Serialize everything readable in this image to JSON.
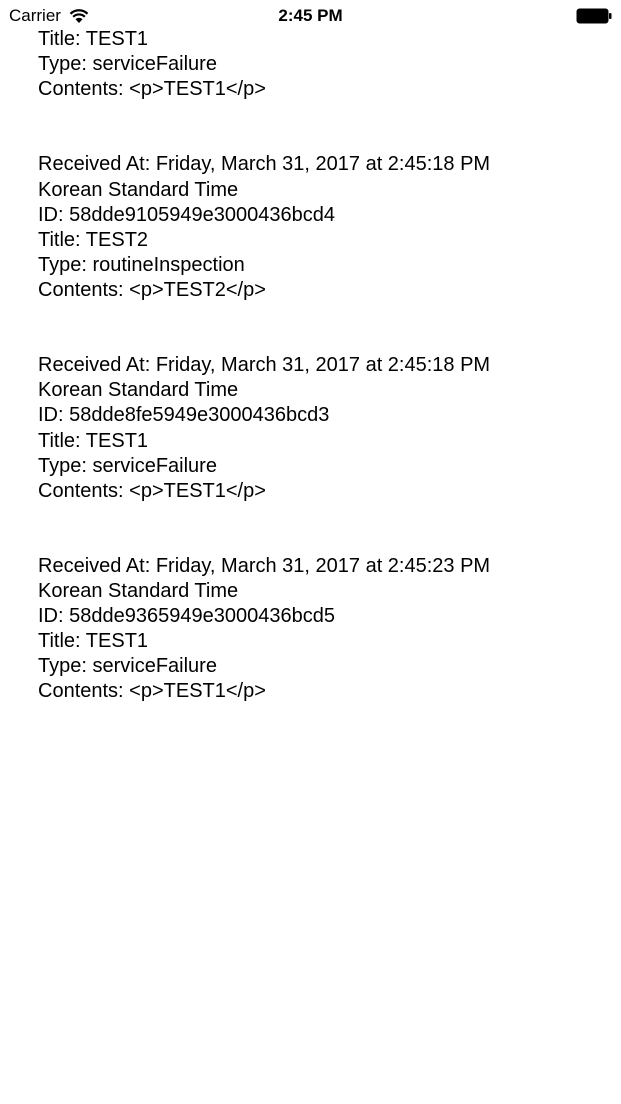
{
  "status_bar": {
    "carrier": "Carrier",
    "time": "2:45 PM"
  },
  "log": {
    "entry0": {
      "title": "Title: TEST1",
      "type": "Type: serviceFailure",
      "contents": "Contents: <p>TEST1</p>"
    },
    "entry1": {
      "received": "Received At: Friday, March 31, 2017 at 2:45:18 PM",
      "timezone": "Korean Standard Time",
      "id": "ID: 58dde9105949e3000436bcd4",
      "title": "Title: TEST2",
      "type": "Type: routineInspection",
      "contents": "Contents: <p>TEST2</p>"
    },
    "entry2": {
      "received": "Received At: Friday, March 31, 2017 at 2:45:18 PM",
      "timezone": "Korean Standard Time",
      "id": "ID: 58dde8fe5949e3000436bcd3",
      "title": "Title: TEST1",
      "type": "Type: serviceFailure",
      "contents": "Contents: <p>TEST1</p>"
    },
    "entry3": {
      "received": "Received At: Friday, March 31, 2017 at 2:45:23 PM",
      "timezone": "Korean Standard Time",
      "id": "ID: 58dde9365949e3000436bcd5",
      "title": "Title: TEST1",
      "type": "Type: serviceFailure",
      "contents": "Contents: <p>TEST1</p>"
    }
  }
}
